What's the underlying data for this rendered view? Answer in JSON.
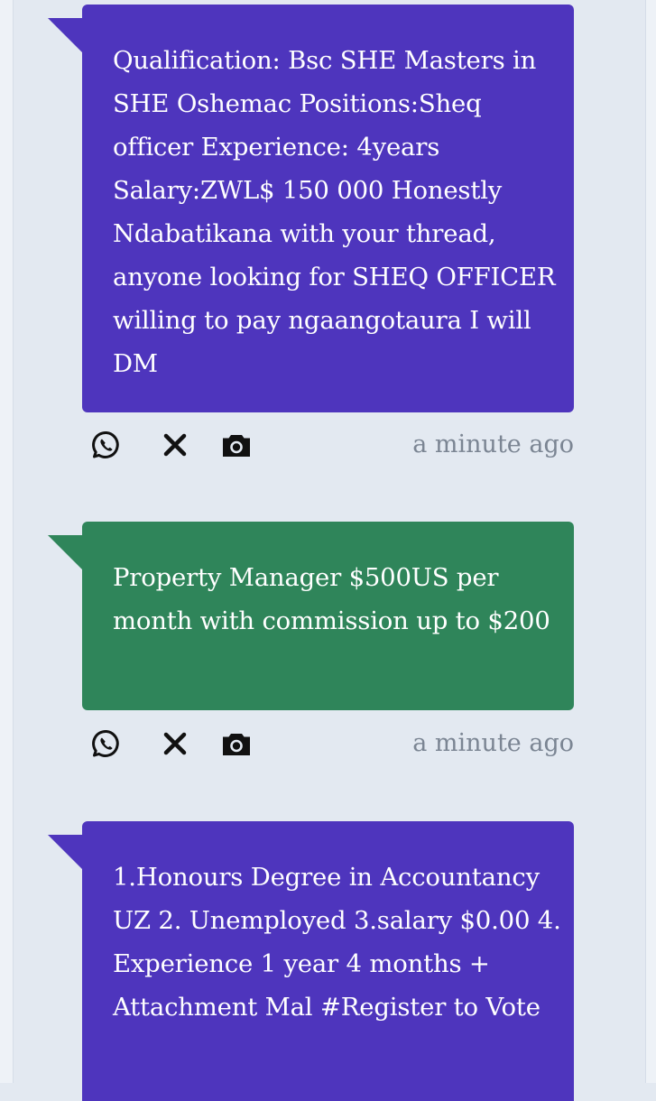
{
  "colors": {
    "background": "#e3e9f1",
    "purple_bubble": "#4e35bd",
    "green_bubble": "#2f855a",
    "timestamp": "#7b8593",
    "icon": "#111111"
  },
  "posts": [
    {
      "color": "purple",
      "text": "Qualification: Bsc SHE Masters in SHE Oshemac Positions:Sheq officer Experience: 4years Salary:ZWL$ 150 000 Honestly Ndabatikana with your thread, anyone looking for SHEQ OFFICER willing to pay ngaangotaura I will DM",
      "actions": [
        "whatsapp-icon",
        "close-icon",
        "camera-icon"
      ],
      "timestamp": "a minute ago"
    },
    {
      "color": "green",
      "text": "Property Manager $500US per month with commission up to $200",
      "actions": [
        "whatsapp-icon",
        "close-icon",
        "camera-icon"
      ],
      "timestamp": "a minute ago"
    },
    {
      "color": "purple",
      "text": "1.Honours Degree in Accountancy UZ 2. Unemployed 3.salary $0.00 4. Experience 1 year 4 months + Attachment Mal #Register to Vote"
    }
  ]
}
